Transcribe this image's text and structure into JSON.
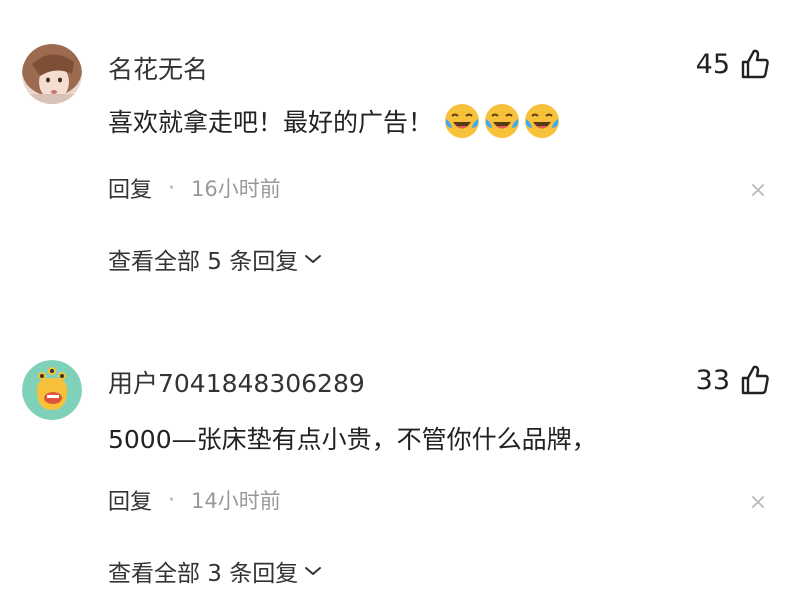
{
  "comments": [
    {
      "username": "名花无名",
      "text": "喜欢就拿走吧！最好的广告！",
      "emoji": [
        "crying-laughing-emoji",
        "crying-laughing-emoji",
        "crying-laughing-emoji"
      ],
      "likes": "45",
      "reply_label": "回复",
      "separator": "·",
      "time": "16小时前",
      "view_replies": "查看全部 5 条回复"
    },
    {
      "username": "用户7041848306289",
      "text": "5000—张床垫有点小贵，不管你什么品牌，",
      "emoji": [],
      "likes": "33",
      "reply_label": "回复",
      "separator": "·",
      "time": "14小时前",
      "view_replies": "查看全部 3 条回复"
    }
  ],
  "colors": {
    "text_primary": "#222222",
    "text_secondary": "#999999",
    "emoji_yellow": "#F7C23A",
    "emoji_tear": "#3FA9F5",
    "avatar2_bg": "#7FD1B9"
  }
}
